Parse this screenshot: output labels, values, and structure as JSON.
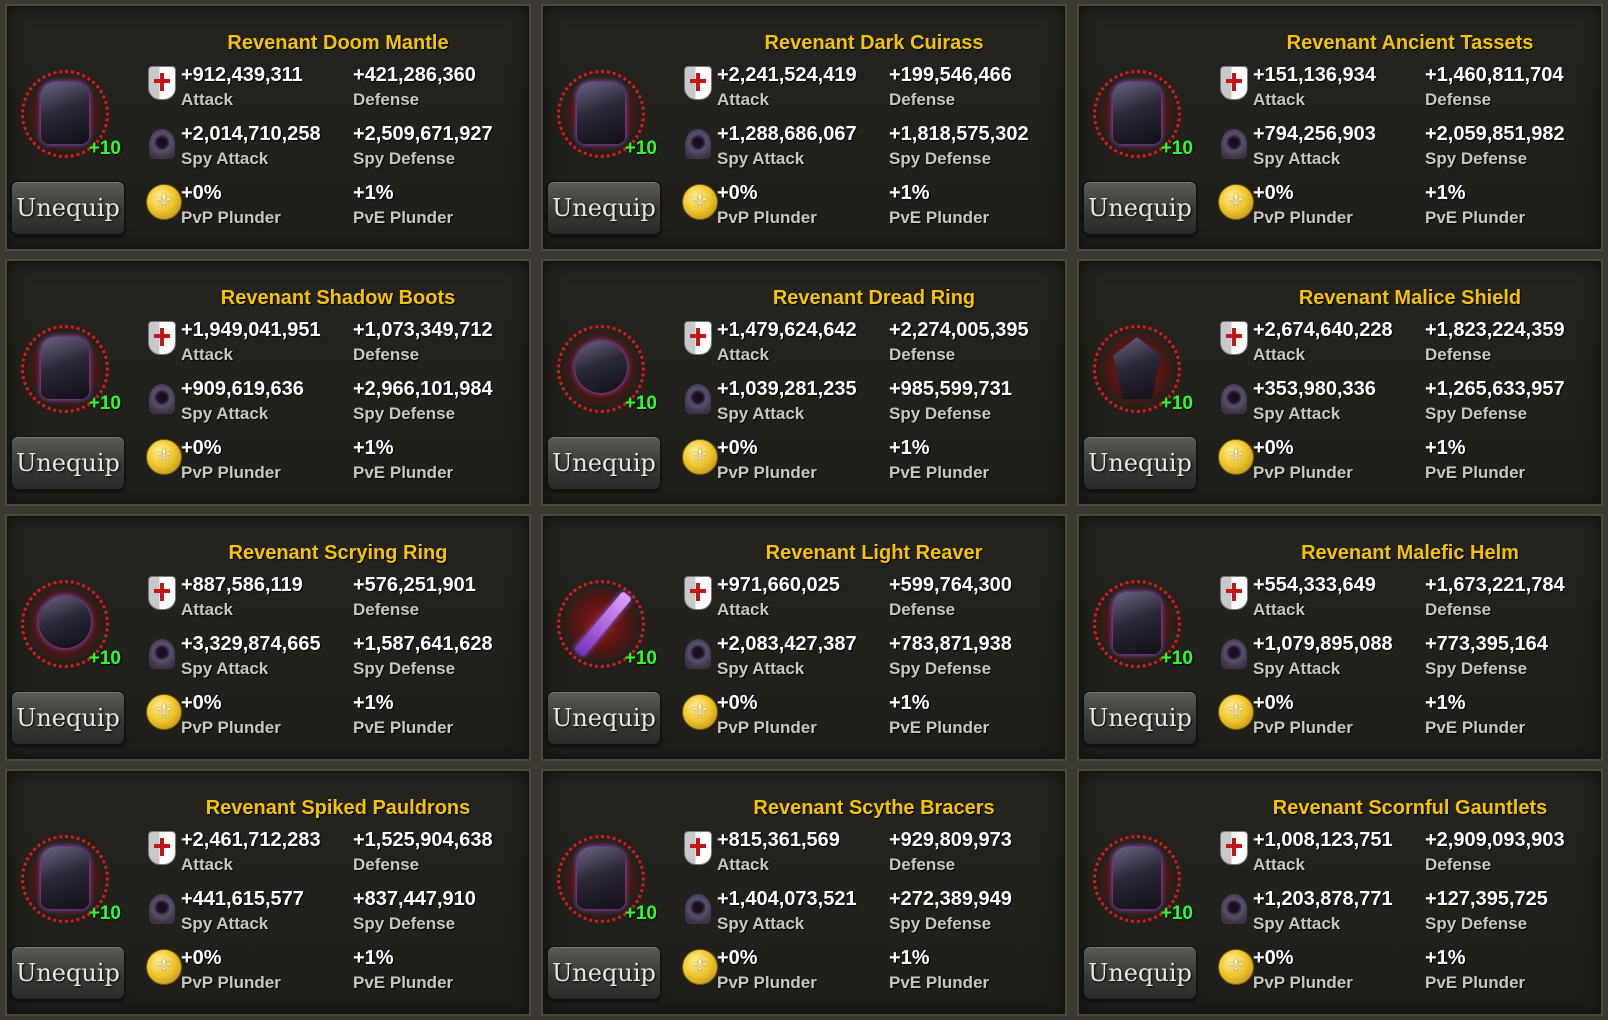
{
  "labels": {
    "attack": "Attack",
    "defense": "Defense",
    "spy_attack": "Spy Attack",
    "spy_defense": "Spy Defense",
    "pvp_plunder": "PvP Plunder",
    "pve_plunder": "PvE Plunder",
    "unequip": "Unequip",
    "level": "+10"
  },
  "colors": {
    "title": "#f5c400",
    "level": "#2cff2c",
    "glow": "#e01818",
    "background": "#3a382f"
  },
  "items": [
    {
      "name": "Revenant Doom Mantle",
      "icon": "cloak-icon",
      "attack": "+912,439,311",
      "defense": "+421,286,360",
      "spy_attack": "+2,014,710,258",
      "spy_defense": "+2,509,671,927",
      "pvp_plunder": "+0%",
      "pve_plunder": "+1%"
    },
    {
      "name": "Revenant Dark Cuirass",
      "icon": "cuirass-icon",
      "attack": "+2,241,524,419",
      "defense": "+199,546,466",
      "spy_attack": "+1,288,686,067",
      "spy_defense": "+1,818,575,302",
      "pvp_plunder": "+0%",
      "pve_plunder": "+1%"
    },
    {
      "name": "Revenant Ancient Tassets",
      "icon": "tassets-icon",
      "attack": "+151,136,934",
      "defense": "+1,460,811,704",
      "spy_attack": "+794,256,903",
      "spy_defense": "+2,059,851,982",
      "pvp_plunder": "+0%",
      "pve_plunder": "+1%"
    },
    {
      "name": "Revenant Shadow Boots",
      "icon": "boots-icon",
      "attack": "+1,949,041,951",
      "defense": "+1,073,349,712",
      "spy_attack": "+909,619,636",
      "spy_defense": "+2,966,101,984",
      "pvp_plunder": "+0%",
      "pve_plunder": "+1%"
    },
    {
      "name": "Revenant Dread Ring",
      "icon": "skull-ring-icon",
      "attack": "+1,479,624,642",
      "defense": "+2,274,005,395",
      "spy_attack": "+1,039,281,235",
      "spy_defense": "+985,599,731",
      "pvp_plunder": "+0%",
      "pve_plunder": "+1%"
    },
    {
      "name": "Revenant Malice Shield",
      "icon": "shield-icon",
      "attack": "+2,674,640,228",
      "defense": "+1,823,224,359",
      "spy_attack": "+353,980,336",
      "spy_defense": "+1,265,633,957",
      "pvp_plunder": "+0%",
      "pve_plunder": "+1%"
    },
    {
      "name": "Revenant Scrying Ring",
      "icon": "ring-icon",
      "attack": "+887,586,119",
      "defense": "+576,251,901",
      "spy_attack": "+3,329,874,665",
      "spy_defense": "+1,587,641,628",
      "pvp_plunder": "+0%",
      "pve_plunder": "+1%"
    },
    {
      "name": "Revenant Light Reaver",
      "icon": "sword-icon",
      "attack": "+971,660,025",
      "defense": "+599,764,300",
      "spy_attack": "+2,083,427,387",
      "spy_defense": "+783,871,938",
      "pvp_plunder": "+0%",
      "pve_plunder": "+1%"
    },
    {
      "name": "Revenant Malefic Helm",
      "icon": "helm-icon",
      "attack": "+554,333,649",
      "defense": "+1,673,221,784",
      "spy_attack": "+1,079,895,088",
      "spy_defense": "+773,395,164",
      "pvp_plunder": "+0%",
      "pve_plunder": "+1%"
    },
    {
      "name": "Revenant Spiked Pauldrons",
      "icon": "pauldrons-icon",
      "attack": "+2,461,712,283",
      "defense": "+1,525,904,638",
      "spy_attack": "+441,615,577",
      "spy_defense": "+837,447,910",
      "pvp_plunder": "+0%",
      "pve_plunder": "+1%"
    },
    {
      "name": "Revenant Scythe Bracers",
      "icon": "bracers-icon",
      "attack": "+815,361,569",
      "defense": "+929,809,973",
      "spy_attack": "+1,404,073,521",
      "spy_defense": "+272,389,949",
      "pvp_plunder": "+0%",
      "pve_plunder": "+1%"
    },
    {
      "name": "Revenant Scornful Gauntlets",
      "icon": "gauntlets-icon",
      "attack": "+1,008,123,751",
      "defense": "+2,909,093,903",
      "spy_attack": "+1,203,878,771",
      "spy_defense": "+127,395,725",
      "pvp_plunder": "+0%",
      "pve_plunder": "+1%"
    }
  ]
}
